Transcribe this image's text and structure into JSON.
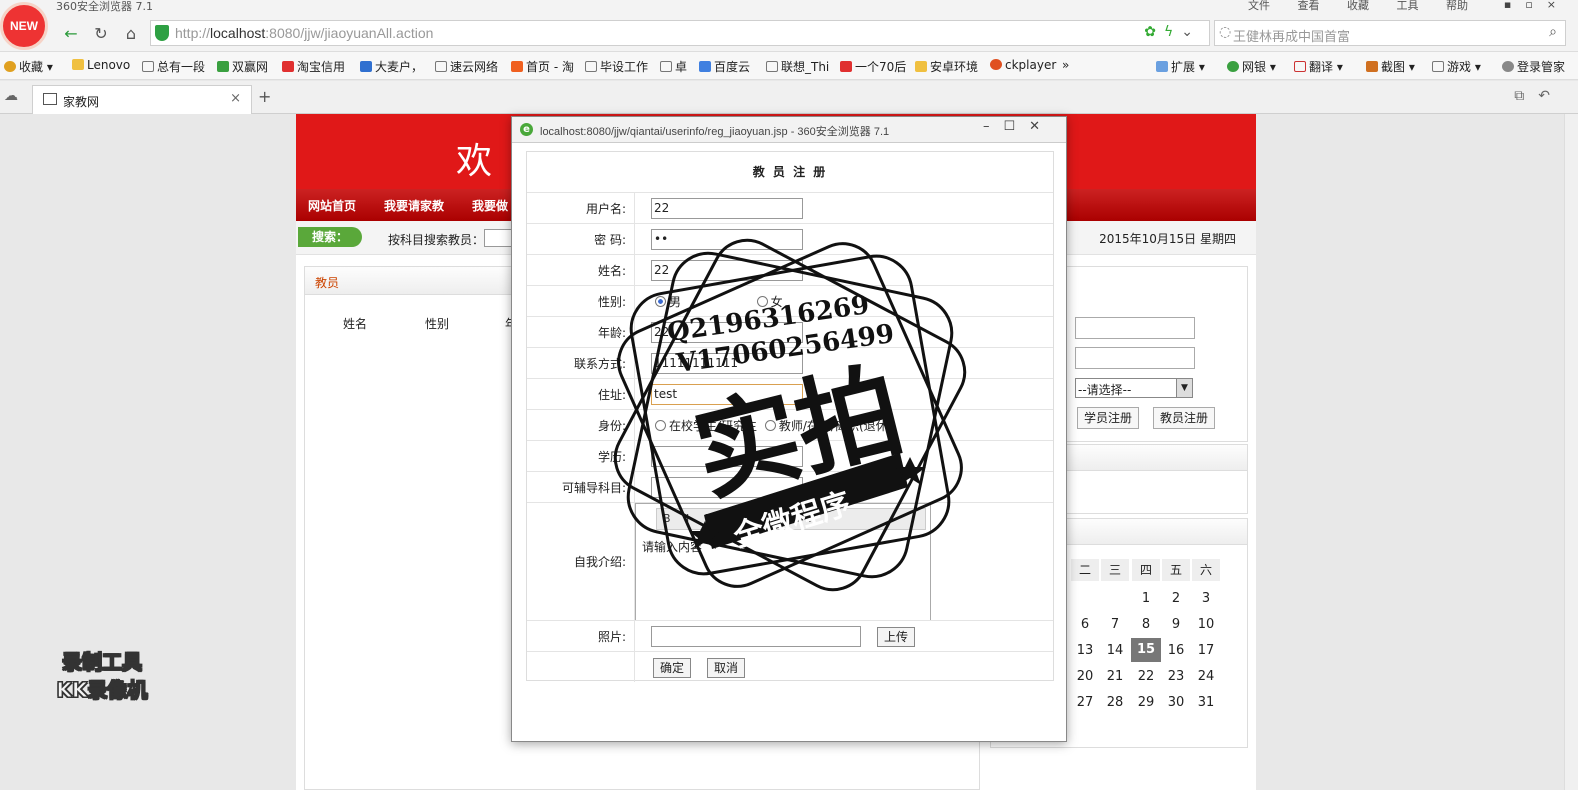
{
  "browser": {
    "app_title": "360安全浏览器 7.1",
    "menus": [
      "文件",
      "查看",
      "收藏",
      "工具",
      "帮助"
    ],
    "logo_text": "NEW",
    "url_gray_prefix": "http://",
    "url_host": "localhost",
    "url_rest": ":8080/jjw/jiaoyuanAll.action",
    "search_placeholder": "王健林再成中国首富",
    "bookmarks": [
      {
        "label": "收藏",
        "color": "#e0a020"
      },
      {
        "label": "Lenovo",
        "color": "#f0c040"
      },
      {
        "label": "总有一段",
        "color": "#ffffff"
      },
      {
        "label": "双赢网",
        "color": "#3aa040"
      },
      {
        "label": "淘宝信用",
        "color": "#e03030"
      },
      {
        "label": "大麦户，",
        "color": "#3070d0"
      },
      {
        "label": "速云网络",
        "color": "#ffffff"
      },
      {
        "label": "首页 - 淘",
        "color": "#f06020"
      },
      {
        "label": "毕设工作",
        "color": "#ffffff"
      },
      {
        "label": "卓",
        "color": "#ffffff"
      },
      {
        "label": "百度云",
        "color": "#4080e0"
      },
      {
        "label": "联想_Thi",
        "color": "#ffffff"
      },
      {
        "label": "一个70后",
        "color": "#e03030"
      },
      {
        "label": "安卓环境",
        "color": "#f0c040"
      },
      {
        "label": "ckplayer",
        "color": "#e05020"
      }
    ],
    "bookmark_more": "»",
    "toolbar_right": [
      "扩展",
      "网银",
      "翻译",
      "截图",
      "游戏",
      "登录管家"
    ],
    "tab_label": "家教网"
  },
  "page": {
    "banner_text": "欢",
    "nav": [
      "网站首页",
      "我要请家教",
      "我要做"
    ],
    "search_tag": "搜索：",
    "search_label": "按科目搜索教员：",
    "date": "2015年10月15日 星期四",
    "left_header": "教员",
    "columns": [
      "姓名",
      "性别",
      "年"
    ],
    "select_value": "--请选择--",
    "student_register": "学员注册",
    "teacher_register": "教员注册",
    "calendar": {
      "weekdays": [
        "二",
        "三",
        "四",
        "五",
        "六"
      ],
      "rows": [
        [
          "",
          "",
          "1",
          "2",
          "3"
        ],
        [
          "6",
          "7",
          "8",
          "9",
          "10"
        ],
        [
          "13",
          "14",
          "15",
          "16",
          "17"
        ],
        [
          "20",
          "21",
          "22",
          "23",
          "24"
        ],
        [
          "27",
          "28",
          "29",
          "30",
          "31"
        ]
      ],
      "today": "15"
    }
  },
  "popup": {
    "title": "localhost:8080/jjw/qiantai/userinfo/reg_jiaoyuan.jsp - 360安全浏览器 7.1",
    "form_title": "教 员 注 册",
    "labels": {
      "username": "用户名:",
      "password": "密 码:",
      "name": "姓名:",
      "gender": "性别:",
      "age": "年龄:",
      "contact": "联系方式:",
      "address": "住址:",
      "identity": "身份:",
      "education": "学历:",
      "subjects": "可辅导科目:",
      "intro": "自我介绍:",
      "photo": "照片:"
    },
    "values": {
      "username": "22",
      "password": "••",
      "name": "22",
      "age": "22",
      "contact": "11111111111",
      "address": "test"
    },
    "gender_options": [
      "男",
      "女"
    ],
    "identity_options": [
      "在校学生/研究生",
      "教师/在职/离职(退休)"
    ],
    "editor_toolbar": "B I ☰ ☰ ▦ ▦ ?",
    "editor_placeholder": "请输入内容",
    "upload_button": "上传",
    "confirm_button": "确定",
    "cancel_button": "取消"
  },
  "watermark": {
    "qq": "Q2196316269",
    "v": "V17060256499",
    "big": "实拍",
    "banner": "全微程序",
    "recorder_line1": "录制工具",
    "recorder_line2": "KK录像机"
  }
}
